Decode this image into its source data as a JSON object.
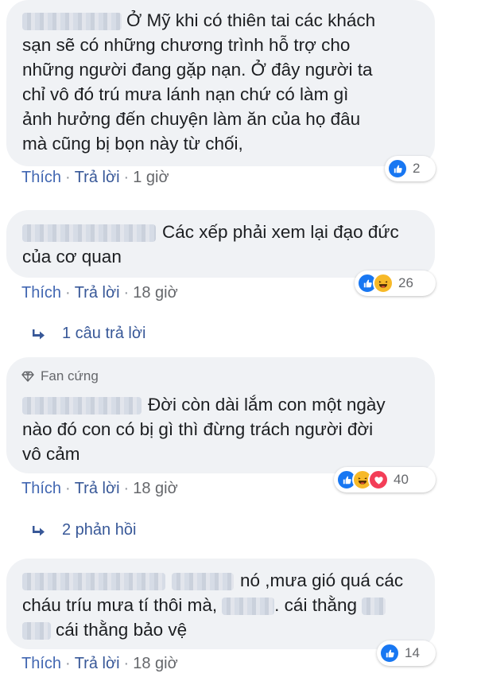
{
  "actions": {
    "like": "Thích",
    "reply": "Trả lời",
    "sep": "·"
  },
  "comments": [
    {
      "text_lines": [
        "Ở Mỹ khi có thiên tai các khách",
        "sạn sẽ có những chương trình hỗ trợ cho",
        "những người đang gặp nạn. Ở đây người ta",
        "chỉ vô đó trú mưa lánh nạn chứ có làm gì",
        "ảnh hưởng đến chuyện làm ăn của họ đâu",
        "mà cũng bị bọn này từ chối,"
      ],
      "time": "1 giờ",
      "reactions": [
        "like"
      ],
      "count": "2"
    },
    {
      "text_lines": [
        "Các xếp phải xem lại đạo đức",
        "của cơ quan"
      ],
      "time": "18 giờ",
      "reactions": [
        "like",
        "haha"
      ],
      "count": "26",
      "replies": "1 câu trả lời"
    },
    {
      "badge": "Fan cứng",
      "text_lines": [
        "Đời còn dài lắm con một ngày",
        "nào đó con có bị gì thì đừng trách người đời",
        "vô cảm"
      ],
      "time": "18 giờ",
      "reactions": [
        "like",
        "haha",
        "love"
      ],
      "count": "40",
      "replies": "2 phản hồi"
    },
    {
      "text_parts": [
        "nó ,mưa gió quá các",
        "cháu tríu mưa tí thôi mà,",
        ". cái thằng",
        "cái thằng bảo vệ"
      ],
      "time": "18 giờ",
      "reactions": [
        "like"
      ],
      "count": "14"
    }
  ]
}
